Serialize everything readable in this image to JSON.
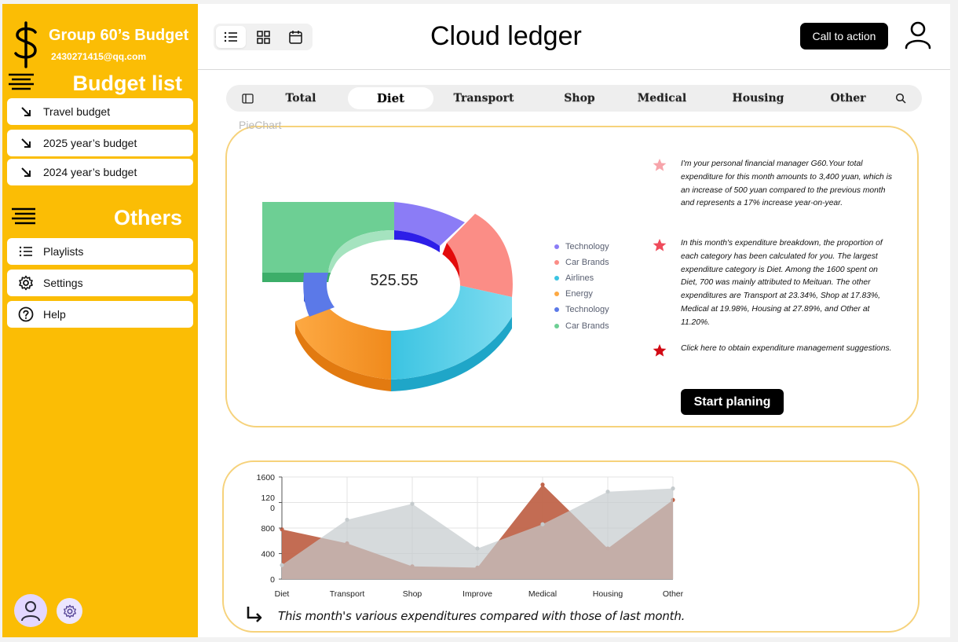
{
  "sidebar": {
    "title": "Group 60’s Budget",
    "email": "2430271415@qq.com",
    "budget_section": "Budget list",
    "budget_items": [
      {
        "label": "Travel budget",
        "icon": "arrow-down-right-icon"
      },
      {
        "label": "2025 year’s budget",
        "icon": "arrow-down-right-icon"
      },
      {
        "label": "2024 year’s budget",
        "icon": "arrow-down-right-icon"
      }
    ],
    "others_section": "Others",
    "other_items": [
      {
        "label": "Playlists",
        "icon": "list-icon"
      },
      {
        "label": "Settings",
        "icon": "gear-icon"
      },
      {
        "label": "Help",
        "icon": "help-icon"
      }
    ]
  },
  "header": {
    "title": "Cloud ledger",
    "cta_label": "Call to action",
    "view_modes": [
      "list",
      "grid",
      "calendar"
    ],
    "active_view": "list"
  },
  "tabs": {
    "items": [
      "Total",
      "Diet",
      "Transport",
      "Shop",
      "Medical",
      "Housing",
      "Other"
    ],
    "active": "Diet"
  },
  "pie_section": {
    "label": "PieChart",
    "center_value": "525.55",
    "legend": [
      {
        "name": "Technology",
        "color": "#8b7cf6"
      },
      {
        "name": "Car Brands",
        "color": "#fb8d86"
      },
      {
        "name": "Airlines",
        "color": "#3bc4e2"
      },
      {
        "name": "Energy",
        "color": "#fda943"
      },
      {
        "name": "Technology",
        "color": "#5b79e8"
      },
      {
        "name": "Car Brands",
        "color": "#6dcf94"
      }
    ],
    "messages": [
      "I'm your personal financial manager G60.Your total expenditure for this month amounts to 3,400 yuan, which is an increase of 500 yuan compared to the previous month and represents a 17% increase year-on-year.",
      "In this month's expenditure breakdown, the proportion of each category has been calculated for you. The largest expenditure category is Diet. Among the 1600 spent on Diet, 700 was mainly attributed to Meituan. The other expenditures are Transport at 23.34%, Shop at 17.83%, Medical at 19.98%, Housing at 27.89%, and Other at 11.20%.",
      "Click here to obtain expenditure management suggestions."
    ],
    "plan_button": "Start planing"
  },
  "chart_data": {
    "type": "area",
    "categories": [
      "Diet",
      "Transport",
      "Shop",
      "Improve",
      "Medical",
      "Housing",
      "Other"
    ],
    "y_tick_labels": [
      "0",
      "400",
      "800",
      "120\n0",
      "1600"
    ],
    "ylim": [
      0,
      1600
    ],
    "grid": true,
    "series": [
      {
        "values": [
          780,
          560,
          200,
          180,
          1480,
          480,
          1240
        ],
        "color": "#c0644a"
      },
      {
        "values": [
          220,
          930,
          1180,
          480,
          860,
          1370,
          1420
        ],
        "color": "#c5cbcd"
      }
    ]
  },
  "caption": "This month's various expenditures compared with those of last month."
}
